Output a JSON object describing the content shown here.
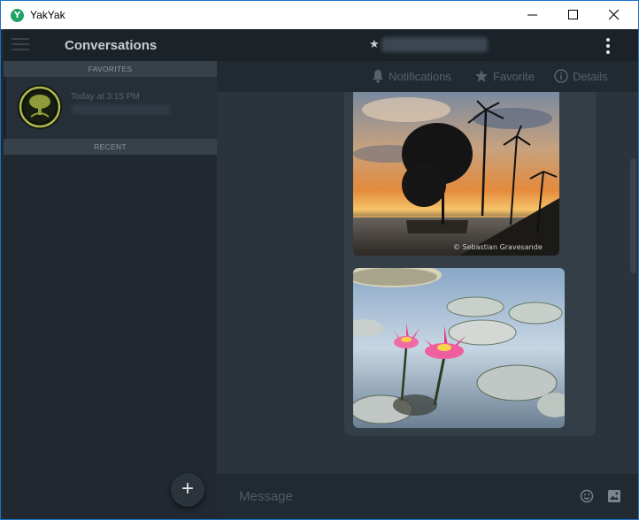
{
  "window": {
    "title": "YakYak",
    "logo_letter": "Y"
  },
  "sidebar": {
    "title": "Conversations",
    "favorites_label": "FAVORITES",
    "recent_label": "RECENT",
    "conversations": [
      {
        "time": "Today at 3:15 PM",
        "preview": ""
      }
    ],
    "add_label": "+"
  },
  "main": {
    "header": {
      "star": "★",
      "contact_name": ""
    },
    "toolbar": {
      "notifications": "Notifications",
      "favorite": "Favorite",
      "details": "Details"
    },
    "message_images": [
      {
        "subject": "palm-tree-sunset-beach",
        "watermark": "© Sebastian Gravesande"
      },
      {
        "subject": "pink-water-lilies"
      }
    ],
    "composer": {
      "placeholder": "Message"
    }
  },
  "colors": {
    "accent": "#1fa363",
    "sidebar_bg": "#212830",
    "header_bg": "#1b2228",
    "main_bg": "#2b343c"
  }
}
